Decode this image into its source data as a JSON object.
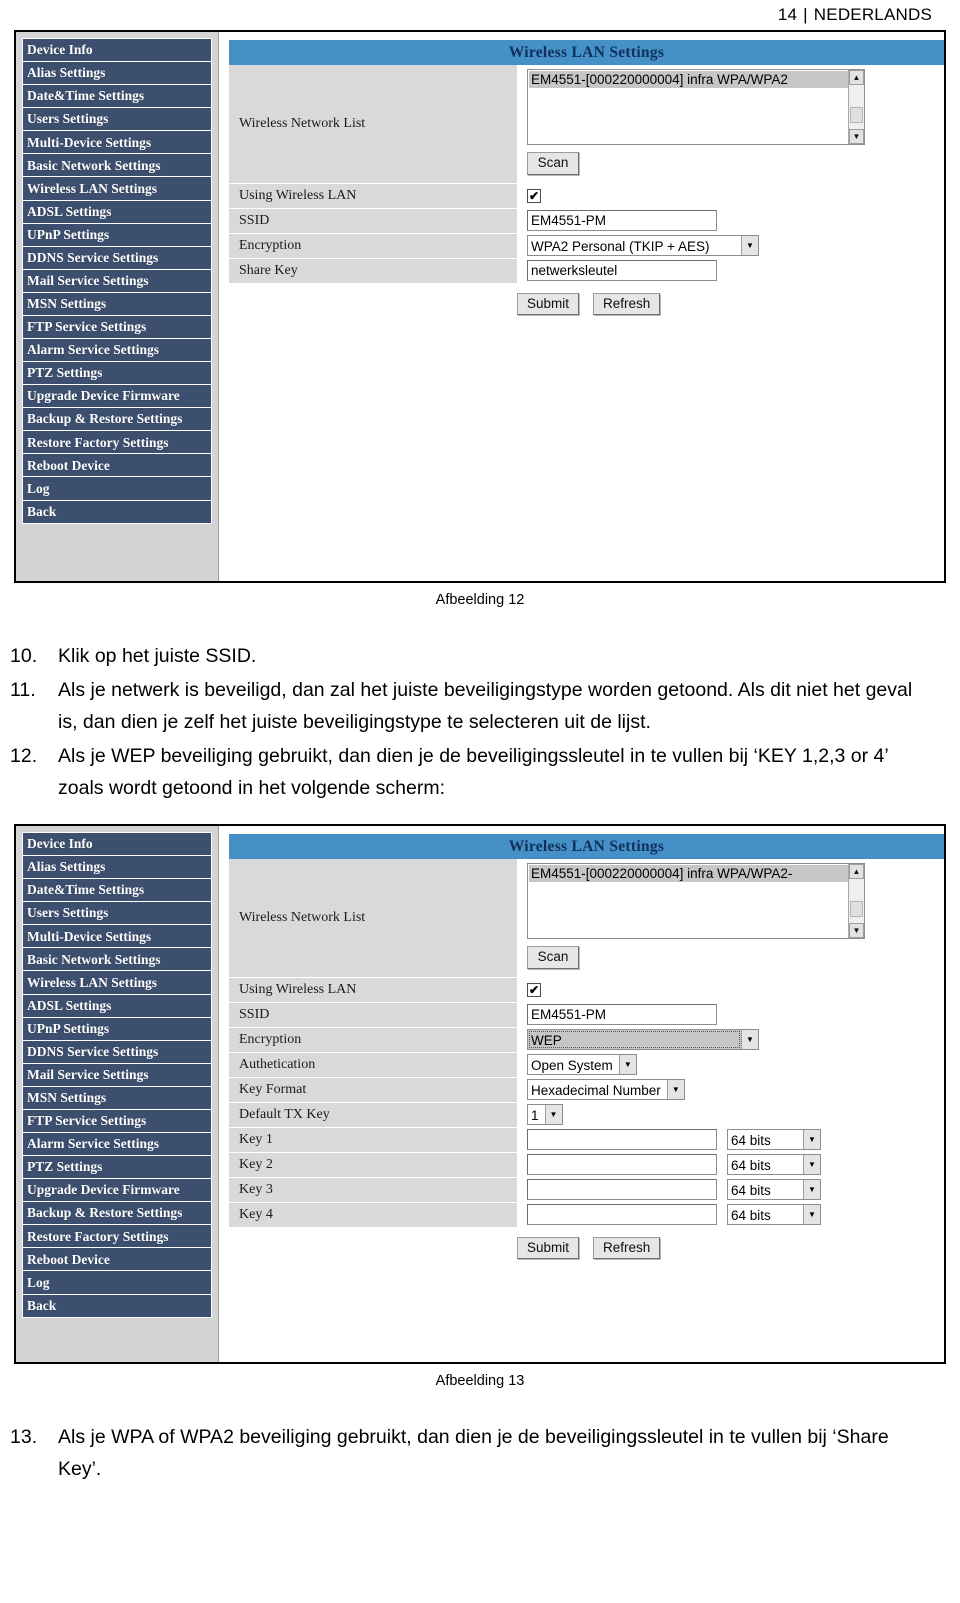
{
  "header": {
    "page_number": "14",
    "separator": "|",
    "language": "NEDERLANDS"
  },
  "sidebar": {
    "items": [
      {
        "label": "Device Info"
      },
      {
        "label": "Alias Settings"
      },
      {
        "label": "Date&Time Settings"
      },
      {
        "label": "Users Settings"
      },
      {
        "label": "Multi-Device Settings"
      },
      {
        "label": "Basic Network Settings"
      },
      {
        "label": "Wireless LAN Settings"
      },
      {
        "label": "ADSL Settings"
      },
      {
        "label": "UPnP Settings"
      },
      {
        "label": "DDNS Service Settings"
      },
      {
        "label": "Mail Service Settings"
      },
      {
        "label": "MSN Settings"
      },
      {
        "label": "FTP Service Settings"
      },
      {
        "label": "Alarm Service Settings"
      },
      {
        "label": "PTZ Settings"
      },
      {
        "label": "Upgrade Device Firmware"
      },
      {
        "label": "Backup & Restore Settings"
      },
      {
        "label": "Restore Factory Settings"
      },
      {
        "label": "Reboot Device"
      },
      {
        "label": "Log"
      },
      {
        "label": "Back"
      }
    ]
  },
  "figure12": {
    "panel_title": "Wireless LAN Settings",
    "labels": {
      "network_list": "Wireless Network List",
      "using_wlan": "Using Wireless LAN",
      "ssid": "SSID",
      "encryption": "Encryption",
      "share_key": "Share Key"
    },
    "network_list_option": "EM4551-[000220000004] infra WPA/WPA2",
    "scan_button": "Scan",
    "using_wlan_checked": "✔",
    "ssid_value": "EM4551-PM",
    "encryption_value": "WPA2 Personal (TKIP + AES)",
    "share_key_value": "netwerksleutel",
    "submit_button": "Submit",
    "refresh_button": "Refresh",
    "caption": "Afbeelding 12"
  },
  "figure13": {
    "panel_title": "Wireless LAN Settings",
    "labels": {
      "network_list": "Wireless Network List",
      "using_wlan": "Using Wireless LAN",
      "ssid": "SSID",
      "encryption": "Encryption",
      "authentication": "Authetication",
      "key_format": "Key Format",
      "default_tx_key": "Default TX Key",
      "key1": "Key 1",
      "key2": "Key 2",
      "key3": "Key 3",
      "key4": "Key 4"
    },
    "network_list_option": "EM4551-[000220000004] infra WPA/WPA2-",
    "scan_button": "Scan",
    "using_wlan_checked": "✔",
    "ssid_value": "EM4551-PM",
    "encryption_value": "WEP",
    "authentication_value": "Open System",
    "key_format_value": "Hexadecimal Number",
    "default_tx_key_value": "1",
    "key1_value": "",
    "key2_value": "",
    "key3_value": "",
    "key4_value": "",
    "key1_bits": "64 bits",
    "key2_bits": "64 bits",
    "key3_bits": "64 bits",
    "key4_bits": "64 bits",
    "submit_button": "Submit",
    "refresh_button": "Refresh",
    "caption": "Afbeelding 13"
  },
  "steps_group_1": [
    {
      "num": "10.",
      "text": "Klik op het juiste SSID."
    },
    {
      "num": "11.",
      "text": "Als je netwerk is beveiligd, dan zal het juiste beveiligingstype worden getoond. Als dit niet het geval is, dan dien je zelf het juiste beveiligingstype te selecteren uit de lijst."
    },
    {
      "num": "12.",
      "text": "Als je WEP beveiliging gebruikt, dan dien je de beveiligingssleutel in te vullen bij ‘KEY 1,2,3 or 4’ zoals wordt getoond in het volgende scherm:"
    }
  ],
  "steps_group_2": [
    {
      "num": "13.",
      "text": "Als je WPA of WPA2 beveiliging gebruikt, dan dien je de beveiligingssleutel in te vullen bij ‘Share Key’."
    }
  ],
  "colors": {
    "sidebar_item": "#3d4f6e",
    "panel_title_bar": "#4590c6",
    "panel_title_text": "#10305c",
    "label_cell": "#d9d9d9",
    "sidebar_bg": "#d4d4d4"
  },
  "icons": {
    "scroll_up": "▲",
    "scroll_down": "▼",
    "dropdown_arrow": "▼"
  }
}
